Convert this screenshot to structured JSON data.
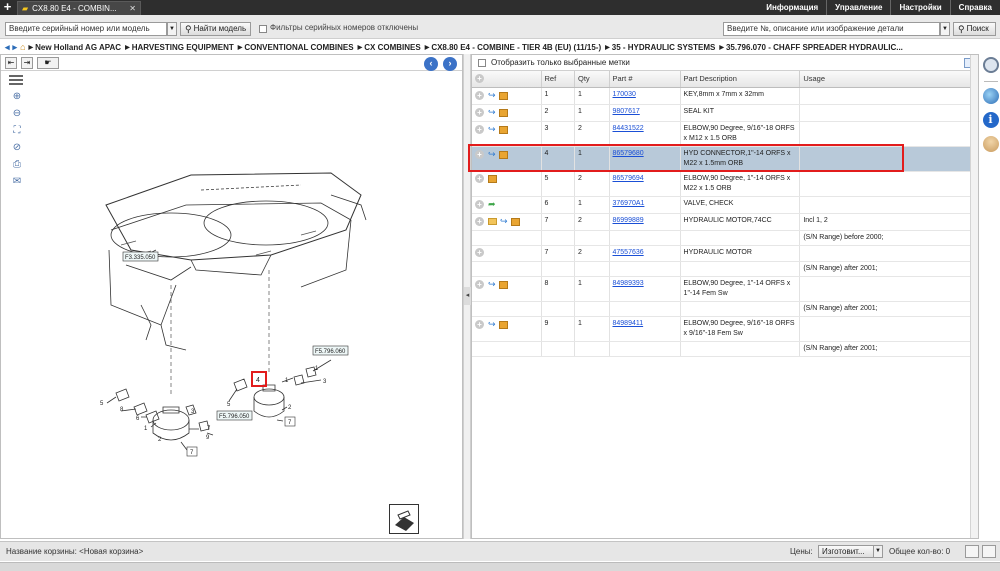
{
  "tab": {
    "title": "CX8.80 E4 - COMBIN...",
    "close": "✕"
  },
  "top_menu": [
    "Информация",
    "Управление",
    "Настройки",
    "Справка"
  ],
  "search": {
    "serial_placeholder": "Введите серийный номер или модель",
    "find_model_label": "Найти модель",
    "filter_label": "Фильтры серийных номеров отключены",
    "part_placeholder": "Введите №, описание или изображение детали",
    "search_label": "Поиск"
  },
  "breadcrumb": [
    "New Holland AG APAC",
    "HARVESTING EQUIPMENT",
    "CONVENTIONAL COMBINES",
    "CX COMBINES",
    "CX8.80 E4 - COMBINE - TIER 4B (EU) (11/15-)",
    "35 - HYDRAULIC SYSTEMS",
    "35.796.070 - CHAFF SPREADER HYDRAULIC..."
  ],
  "drawing": {
    "callouts": [
      "F3.335.050",
      "F5.796.050",
      "F5.796.060",
      "7",
      "7"
    ],
    "refs": [
      "1",
      "2",
      "3",
      "4",
      "5",
      "6",
      "7",
      "8",
      "9",
      "1",
      "2",
      "3",
      "5",
      "1"
    ]
  },
  "parts_panel": {
    "show_selected_label": "Отобразить только выбранные метки",
    "columns": [
      "Ref",
      "Qty",
      "Part #",
      "Part Description",
      "Usage"
    ],
    "rows": [
      {
        "ref": "1",
        "qty": "1",
        "part": "170030",
        "desc": "KEY,8mm x 7mm x 32mm",
        "usage": ""
      },
      {
        "ref": "2",
        "qty": "1",
        "part": "9807617",
        "desc": "SEAL KIT",
        "usage": ""
      },
      {
        "ref": "3",
        "qty": "2",
        "part": "84431522",
        "desc": "ELBOW,90 Degree, 9/16\"-18 ORFS x M12 x 1.5 ORB",
        "usage": ""
      },
      {
        "ref": "4",
        "qty": "1",
        "part": "86579680",
        "desc": "HYD CONNECTOR,1\"-14 ORFS x M22 x 1.5mm ORB",
        "usage": ""
      },
      {
        "ref": "5",
        "qty": "2",
        "part": "86579694",
        "desc": "ELBOW,90 Degree, 1\"-14 ORFS x M22 x 1.5 ORB",
        "usage": ""
      },
      {
        "ref": "6",
        "qty": "1",
        "part": "376970A1",
        "desc": "VALVE, CHECK",
        "usage": ""
      },
      {
        "ref": "7",
        "qty": "2",
        "part": "86999889",
        "desc": "HYDRAULIC MOTOR,74CC",
        "usage": "Incl 1, 2",
        "usage2": "(S/N Range) before 2000;"
      },
      {
        "ref": "7",
        "qty": "2",
        "part": "47557636",
        "desc": "HYDRAULIC MOTOR",
        "usage": "",
        "usage2": "(S/N Range) after 2001;"
      },
      {
        "ref": "8",
        "qty": "1",
        "part": "84989393",
        "desc": "ELBOW,90 Degree, 1\"-14 ORFS x 1\"-14 Fem Sw",
        "usage": "",
        "usage2": "(S/N Range) after 2001;"
      },
      {
        "ref": "9",
        "qty": "1",
        "part": "84989411",
        "desc": "ELBOW,90 Degree, 9/16\"-18 ORFS x 9/16\"-18 Fem Sw",
        "usage": "",
        "usage2": "(S/N Range) after 2001;"
      }
    ]
  },
  "status": {
    "basket_label": "Название корзины:",
    "basket_value": "<Новая корзина>",
    "prices_label": "Цены:",
    "prices_value": "Изготовит...",
    "total_label": "Общее кол-во: 0"
  },
  "colors": {
    "selected_row": "#b8c9d9",
    "highlight": "#e21c1c",
    "link": "#1a4fd6",
    "topbar": "#2e2e2e"
  }
}
